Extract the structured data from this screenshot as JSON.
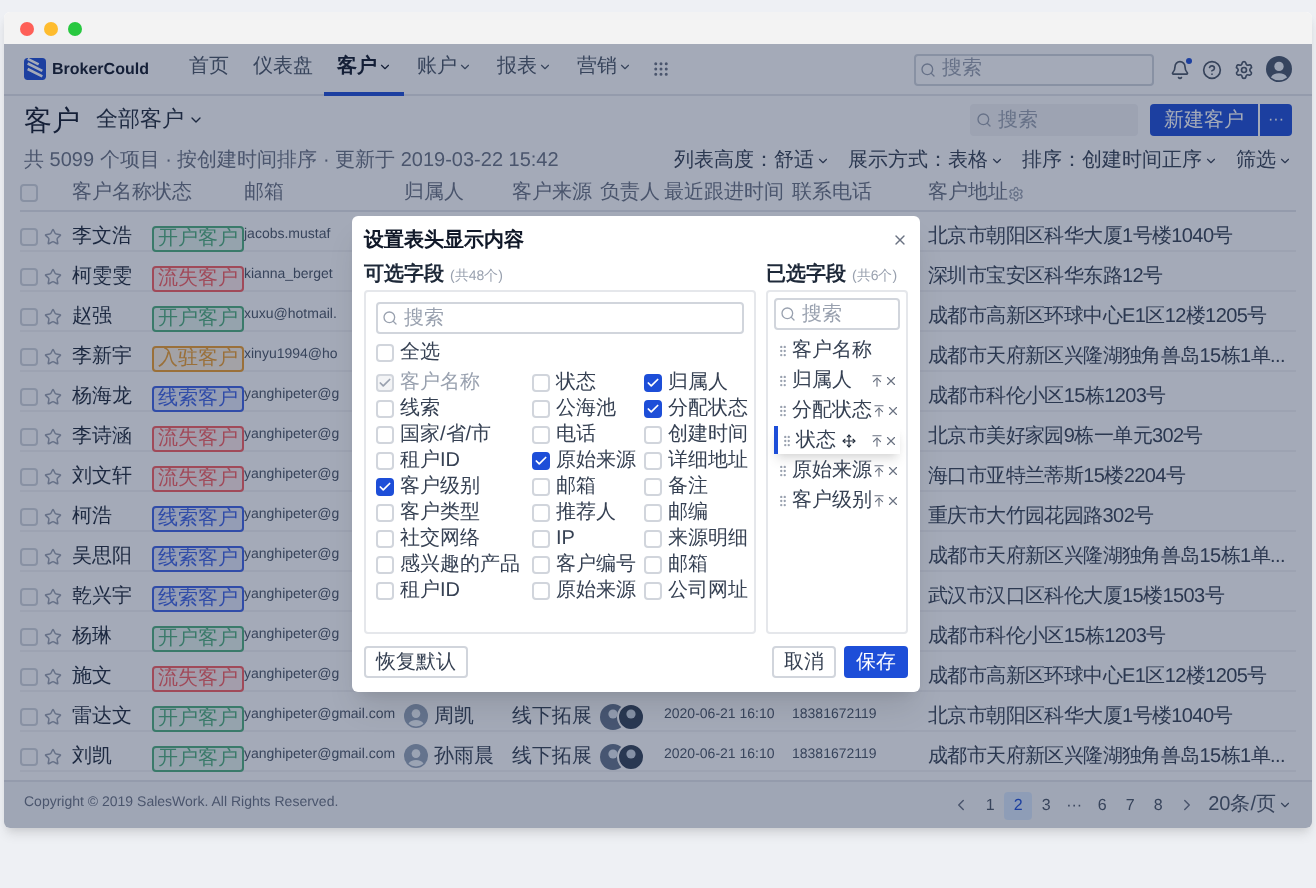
{
  "nav": {
    "logo": "BrokerCould",
    "items": [
      {
        "label": "首页",
        "selected": false,
        "has_menu": false
      },
      {
        "label": "仪表盘",
        "selected": false,
        "has_menu": false
      },
      {
        "label": "客户",
        "selected": true,
        "has_menu": true
      },
      {
        "label": "账户",
        "selected": false,
        "has_menu": true
      },
      {
        "label": "报表",
        "selected": false,
        "has_menu": true
      },
      {
        "label": "营销",
        "selected": false,
        "has_menu": true
      }
    ],
    "search": {
      "placeholder": "搜索"
    },
    "notification_dot": true
  },
  "page_header": {
    "title": "客户",
    "view": "全部客户",
    "search": {
      "placeholder": "搜索"
    },
    "primary_button": "新建客户",
    "more_button": "···"
  },
  "info": {
    "summary": "共 5099 个项目 · 按创建时间排序 · 更新于 2019-03-22 15:42",
    "options": [
      "列表高度：舒适",
      "展示方式：表格",
      "排序：创建时间正序",
      "筛选"
    ]
  },
  "table": {
    "columns": [
      "客户名称",
      "状态",
      "邮箱",
      "归属人",
      "客户来源",
      "负责人",
      "最近跟进时间",
      "联系电话",
      "客户地址"
    ],
    "select_all_checked": false,
    "rows": [
      {
        "kind": "partial",
        "checked": false,
        "starred": false,
        "name": "李文浩",
        "status": "开户客户",
        "color": "#3a7a6a",
        "email": "jacobs.mustaf",
        "address": "北京市朝阳区科华大厦1号楼1040号"
      },
      {
        "kind": "partial",
        "checked": false,
        "starred": false,
        "name": "柯雯雯",
        "status": "流失客户",
        "color": "#a04a5a",
        "email": "kianna_berget",
        "address": "深圳市宝安区科华东路12号"
      },
      {
        "kind": "partial",
        "checked": false,
        "starred": false,
        "name": "赵强",
        "status": "开户客户",
        "color": "#3a7a6a",
        "email": "xuxu@hotmail.",
        "address": "成都市高新区环球中心E1区12楼1205号"
      },
      {
        "kind": "partial",
        "checked": false,
        "starred": false,
        "name": "李新宇",
        "status": "入驻客户",
        "color": "#9a703a",
        "email": "xinyu1994@ho",
        "address": "成都市天府新区兴隆湖独角兽岛15栋1单..."
      },
      {
        "kind": "partial",
        "checked": false,
        "starred": false,
        "name": "杨海龙",
        "status": "线索客户",
        "color": "#304ca8",
        "email": "yanghipeter@g",
        "address": "成都市科伦小区15栋1203号"
      },
      {
        "kind": "partial",
        "checked": false,
        "starred": false,
        "name": "李诗涵",
        "status": "流失客户",
        "color": "#a04a5a",
        "email": "yanghipeter@g",
        "address": "北京市美好家园9栋一单元302号"
      },
      {
        "kind": "partial",
        "checked": false,
        "starred": false,
        "name": "刘文轩",
        "status": "流失客户",
        "color": "#a04a5a",
        "email": "yanghipeter@g",
        "address": "海口市亚特兰蒂斯15楼2204号"
      },
      {
        "kind": "partial",
        "checked": false,
        "starred": false,
        "name": "柯浩",
        "status": "线索客户",
        "color": "#304ca8",
        "email": "yanghipeter@g",
        "address": "重庆市大竹园花园路302号"
      },
      {
        "kind": "partial",
        "checked": false,
        "starred": false,
        "name": "吴思阳",
        "status": "线索客户",
        "color": "#304ca8",
        "email": "yanghipeter@g",
        "address": "成都市天府新区兴隆湖独角兽岛15栋1单..."
      },
      {
        "kind": "partial",
        "checked": false,
        "starred": false,
        "name": "乾兴宇",
        "status": "线索客户",
        "color": "#304ca8",
        "email": "yanghipeter@g",
        "address": "武汉市汉口区科伦大厦15楼1503号"
      },
      {
        "kind": "partial",
        "checked": false,
        "starred": false,
        "name": "杨琳",
        "status": "开户客户",
        "color": "#3a7a6a",
        "email": "yanghipeter@g",
        "address": "成都市科伦小区15栋1203号"
      },
      {
        "kind": "partial",
        "checked": false,
        "starred": false,
        "name": "施文",
        "status": "流失客户",
        "color": "#a04a5a",
        "email": "yanghipeter@g",
        "address": "成都市高新区环球中心E1区12楼1205号"
      },
      {
        "kind": "full",
        "checked": false,
        "starred": false,
        "name": "雷达文",
        "status": "开户客户",
        "color": "#3a7a6a",
        "email": "yanghipeter@gmail.com",
        "owner": "周凯",
        "source": "线下拓展",
        "time": "2020-06-21 16:10",
        "phone": "18381672119",
        "address": "北京市朝阳区科华大厦1号楼1040号"
      },
      {
        "kind": "full",
        "checked": false,
        "starred": false,
        "name": "刘凯",
        "status": "开户客户",
        "color": "#3a7a6a",
        "email": "yanghipeter@gmail.com",
        "owner": "孙雨晨",
        "source": "线下拓展",
        "time": "2020-06-21 16:10",
        "phone": "18381672119",
        "address": "成都市天府新区兴隆湖独角兽岛15栋1单..."
      }
    ]
  },
  "footer": {
    "copyright": "Copyright © 2019 SalesWork. All Rights Reserved.",
    "pages": [
      {
        "label": "1",
        "selected": false
      },
      {
        "label": "2",
        "selected": true
      },
      {
        "label": "3",
        "selected": false
      },
      {
        "label": "···",
        "selected": false
      },
      {
        "label": "6",
        "selected": false
      },
      {
        "label": "7",
        "selected": false
      },
      {
        "label": "8",
        "selected": false
      }
    ],
    "page_size": "20条/页"
  },
  "dialog": {
    "title": "设置表头显示内容",
    "available": {
      "label": "可选字段",
      "count": "(共48个)",
      "search_placeholder": "搜索",
      "select_all": {
        "label": "全选",
        "checked": false
      },
      "fields": [
        {
          "label": "客户名称",
          "checked": true,
          "disabled": true
        },
        {
          "label": "状态",
          "checked": false,
          "disabled": false
        },
        {
          "label": "归属人",
          "checked": true,
          "disabled": false
        },
        {
          "label": "线索",
          "checked": false,
          "disabled": false
        },
        {
          "label": "公海池",
          "checked": false,
          "disabled": false
        },
        {
          "label": "分配状态",
          "checked": true,
          "disabled": false
        },
        {
          "label": "国家/省/市",
          "checked": false,
          "disabled": false
        },
        {
          "label": "电话",
          "checked": false,
          "disabled": false
        },
        {
          "label": "创建时间",
          "checked": false,
          "disabled": false
        },
        {
          "label": "租户ID",
          "checked": false,
          "disabled": false
        },
        {
          "label": "原始来源",
          "checked": true,
          "disabled": false
        },
        {
          "label": "详细地址",
          "checked": false,
          "disabled": false
        },
        {
          "label": "客户级别",
          "checked": true,
          "disabled": false
        },
        {
          "label": "邮箱",
          "checked": false,
          "disabled": false
        },
        {
          "label": "备注",
          "checked": false,
          "disabled": false
        },
        {
          "label": "客户类型",
          "checked": false,
          "disabled": false
        },
        {
          "label": "推荐人",
          "checked": false,
          "disabled": false
        },
        {
          "label": "邮编",
          "checked": false,
          "disabled": false
        },
        {
          "label": "社交网络",
          "checked": false,
          "disabled": false
        },
        {
          "label": "IP",
          "checked": false,
          "disabled": false
        },
        {
          "label": "来源明细",
          "checked": false,
          "disabled": false
        },
        {
          "label": "感兴趣的产品",
          "checked": false,
          "disabled": false
        },
        {
          "label": "客户编号",
          "checked": false,
          "disabled": false
        },
        {
          "label": "邮箱",
          "checked": false,
          "disabled": false
        },
        {
          "label": "租户ID",
          "checked": false,
          "disabled": false
        },
        {
          "label": "原始来源",
          "checked": false,
          "disabled": false
        },
        {
          "label": "公司网址",
          "checked": false,
          "disabled": false
        }
      ]
    },
    "selected": {
      "label": "已选字段",
      "count": "(共6个)",
      "search_placeholder": "搜索",
      "fields": [
        {
          "label": "客户名称",
          "removable": false,
          "dragging": false
        },
        {
          "label": "归属人",
          "removable": true,
          "dragging": false
        },
        {
          "label": "分配状态",
          "removable": true,
          "dragging": false
        },
        {
          "label": "状态",
          "removable": true,
          "dragging": true
        },
        {
          "label": "原始来源",
          "removable": true,
          "dragging": false
        },
        {
          "label": "客户级别",
          "removable": true,
          "dragging": false
        }
      ]
    },
    "buttons": {
      "reset": "恢复默认",
      "cancel": "取消",
      "save": "保存"
    }
  }
}
